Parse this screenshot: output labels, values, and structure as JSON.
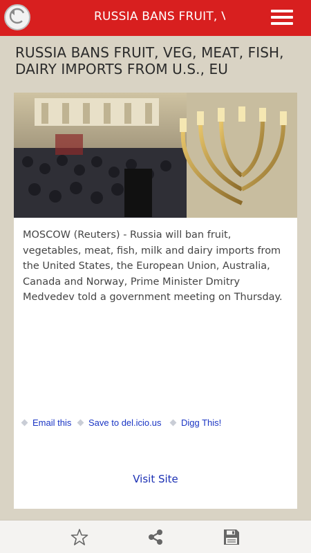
{
  "header": {
    "title": "RUSSIA BANS FRUIT, V...",
    "back_icon": "back-arrow-icon",
    "menu_icon": "hamburger-menu-icon",
    "color": "#d81f1f"
  },
  "article": {
    "headline": "RUSSIA BANS FRUIT, VEG, MEAT, FISH, DAIRY IMPORTS FROM U.S., EU",
    "summary": "MOSCOW (Reuters) - Russia will ban fruit, vegetables, meat, fish, milk and dairy imports from the United States, the European Union, Australia, Canada and Norway, Prime Minister Dmitry Medvedev told a government meeting on Thursday.",
    "share_links": [
      {
        "label": "Email this"
      },
      {
        "label": "Save to del.icio.us"
      },
      {
        "label": "Digg This!"
      }
    ],
    "visit_site_label": "Visit Site"
  },
  "bottom_bar": {
    "icons": [
      "star-icon",
      "share-icon",
      "save-disk-icon"
    ]
  }
}
